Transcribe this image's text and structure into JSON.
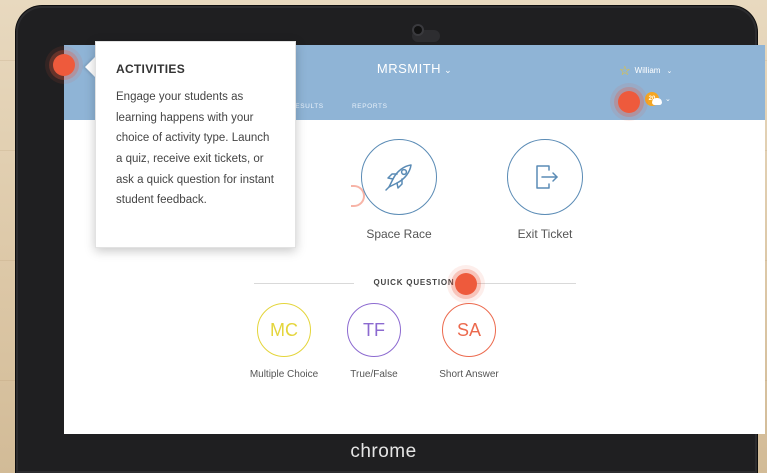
{
  "header": {
    "class_name": "MRSMITH",
    "caret": "⌄",
    "nav": [
      "RESULTS",
      "REPORTS"
    ],
    "user_name": "William",
    "badge_count": "20",
    "star_icon": "star-icon",
    "accent": "#8fb4d6"
  },
  "activities": [
    {
      "label": "Space Race",
      "icon": "rocket-icon"
    },
    {
      "label": "Exit Ticket",
      "icon": "exit-door-icon"
    }
  ],
  "quick_question": {
    "title": "QUICK QUESTION",
    "items": [
      {
        "abbr": "MC",
        "label": "Multiple Choice",
        "color": "#e4d53b"
      },
      {
        "abbr": "TF",
        "label": "True/False",
        "color": "#8c6ad0"
      },
      {
        "abbr": "SA",
        "label": "Short Answer",
        "color": "#ec6a4e"
      }
    ]
  },
  "tooltip": {
    "title": "ACTIVITIES",
    "body": "Engage your students as learning happens with your choice of activity type. Launch a quiz, receive exit tickets, or ask a quick question for instant student feedback."
  },
  "device": {
    "brand": "chrome"
  },
  "hotspot_color": "#ee5a3c"
}
